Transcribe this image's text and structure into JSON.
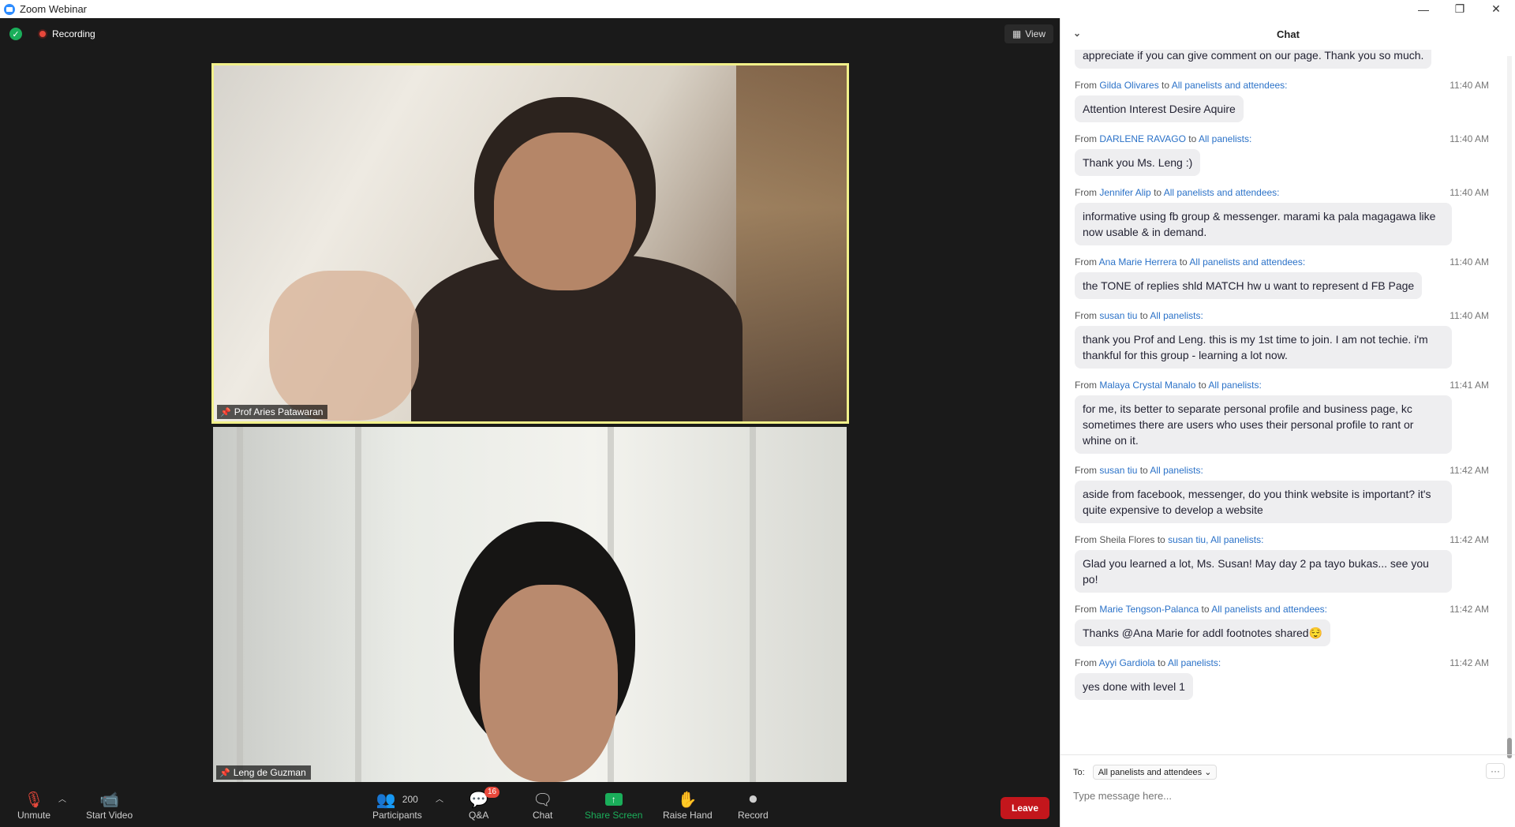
{
  "window": {
    "title": "Zoom Webinar",
    "minimize": "—",
    "restore": "❐",
    "close": "✕"
  },
  "meeting": {
    "security_icon": "✓",
    "recording_label": "Recording",
    "view_label": "View",
    "videos": [
      {
        "name": "Prof Aries Patawaran"
      },
      {
        "name": "Leng de Guzman"
      }
    ]
  },
  "toolbar": {
    "unmute": "Unmute",
    "start_video": "Start Video",
    "participants_count": "200",
    "participants": "Participants",
    "qa": "Q&A",
    "qa_badge": "16",
    "chat": "Chat",
    "share_screen": "Share Screen",
    "raise_hand": "Raise Hand",
    "record": "Record",
    "leave": "Leave"
  },
  "chat": {
    "title": "Chat",
    "partial_message": "appreciate if you can give comment on our page. Thank you so much.",
    "messages": [
      {
        "from": "Gilda Olivares",
        "to": "All panelists and attendees:",
        "time": "11:40 AM",
        "text": "Attention Interest Desire Aquire"
      },
      {
        "from": "DARLENE RAVAGO",
        "to": "All panelists:",
        "time": "11:40 AM",
        "text": "Thank you Ms. Leng :)"
      },
      {
        "from": "Jennifer Alip",
        "to": "All panelists and attendees:",
        "time": "11:40 AM",
        "text": "informative using fb group & messenger. marami ka pala magagawa like now usable & in demand."
      },
      {
        "from": "Ana Marie Herrera",
        "to": "All panelists and attendees:",
        "time": "11:40 AM",
        "text": "the TONE of replies shld MATCH hw u want to represent d FB Page"
      },
      {
        "from": "susan tiu",
        "to": "All panelists:",
        "time": "11:40 AM",
        "text": "thank you Prof and Leng.  this is my 1st time to join.  I am not techie. i'm thankful for this group - learning a lot now."
      },
      {
        "from": "Malaya Crystal Manalo",
        "to": "All panelists:",
        "time": "11:41 AM",
        "text": "for me, its better to separate personal profile and business page, kc sometimes there are users who uses their personal profile to rant or whine on it."
      },
      {
        "from": "susan tiu",
        "to": "All panelists:",
        "time": "11:42 AM",
        "text": "aside from facebook, messenger, do you think website is important? it's quite expensive to develop a website"
      },
      {
        "from": "Sheila  Flores",
        "to": "susan tiu, All panelists:",
        "time": "11:42 AM",
        "text": "Glad you learned a lot, Ms. Susan! May day 2 pa tayo bukas... see you po!",
        "from_plain": true
      },
      {
        "from": "Marie Tengson-Palanca",
        "to": "All panelists and attendees:",
        "time": "11:42 AM",
        "text": "Thanks @Ana Marie for addl footnotes shared😌"
      },
      {
        "from": "Ayyi Gardiola",
        "to": "All panelists:",
        "time": "11:42 AM",
        "text": "yes done with level 1"
      }
    ],
    "from_word": "From",
    "to_word": "to",
    "to_label": "To:",
    "to_select": "All panelists and attendees",
    "more": "···",
    "input_placeholder": "Type message here..."
  }
}
